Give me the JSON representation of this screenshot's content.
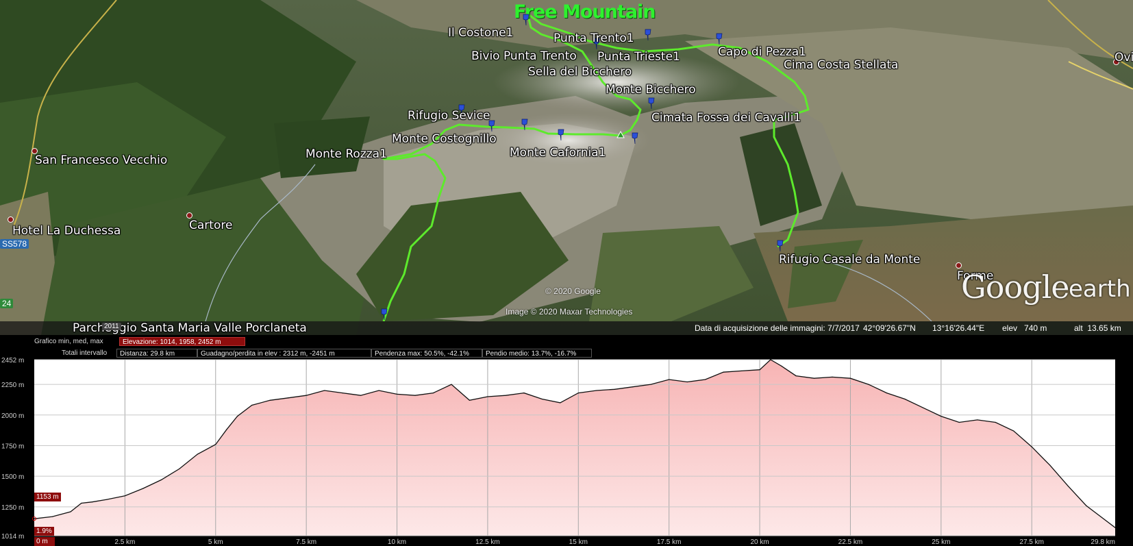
{
  "map": {
    "brand": "Free Mountain",
    "labels": [
      {
        "id": "il-costone",
        "text": "Il Costone1"
      },
      {
        "id": "punta-trento",
        "text": "Punta Trento1"
      },
      {
        "id": "bivio-punta-trento",
        "text": "Bivio Punta Trento"
      },
      {
        "id": "punta-trieste",
        "text": "Punta Trieste1"
      },
      {
        "id": "capo-di-pezza",
        "text": "Capo di Pezza1"
      },
      {
        "id": "cima-costa-stellata",
        "text": "Cima Costa Stellata"
      },
      {
        "id": "sella-del-bicchero",
        "text": "Sella del Bicchero"
      },
      {
        "id": "monte-bicchero",
        "text": "Monte Bicchero"
      },
      {
        "id": "rifugio-sevice",
        "text": "Rifugio Sevice"
      },
      {
        "id": "cimata-fossa",
        "text": "Cimata Fossa dei Cavalli1"
      },
      {
        "id": "monte-costognillo",
        "text": "Monte Costognillo"
      },
      {
        "id": "monte-rozza",
        "text": "Monte Rozza1"
      },
      {
        "id": "monte-cafornia",
        "text": "Monte Cafornia1"
      },
      {
        "id": "san-francesco",
        "text": "San Francesco Vecchio"
      },
      {
        "id": "hotel-la-duchessa",
        "text": "Hotel La Duchessa"
      },
      {
        "id": "cartore",
        "text": "Cartore"
      },
      {
        "id": "rifugio-casale",
        "text": "Rifugio Casale da Monte"
      },
      {
        "id": "forme",
        "text": "Forme"
      },
      {
        "id": "parcheggio",
        "text": "Parcheggio Santa Maria Valle Porclaneta"
      },
      {
        "id": "ovi",
        "text": "Ovi"
      }
    ],
    "road_badges": [
      "SS578",
      "24"
    ],
    "year_badge": "2011",
    "copyright_google": "© 2020 Google",
    "copyright_image": "Image © 2020 Maxar Technologies",
    "logo_text": "Google",
    "logo_suffix": "earth"
  },
  "status": {
    "capture_date": "Data di acquisizione delle immagini: 7/7/2017",
    "lat": "42°09'26.67\"N",
    "lon": "13°16'26.44\"E",
    "elev": "elev   740 m",
    "alt": "alt  13.65 km"
  },
  "profile": {
    "header_label": "Grafico  min, med, max",
    "elevation": "Elevazione: 1014, 1958, 2452 m",
    "totals_label": "Totali intervallo",
    "distance": "Distanza: 29.8 km",
    "gain_loss": "Guadagno/perdita in elev : 2312 m, -2451 m",
    "slope_max": "Pendenza max: 50.5%, -42.1%",
    "slope_avg": "Pendio medio: 13.7%, -16.7%",
    "start_elev_marker": "1153 m",
    "start_slope_marker": "1.9%",
    "start_dist_marker": "0 m"
  },
  "colors": {
    "track": "#5dea2c",
    "brand": "#2ef12e",
    "profile_fill_top": "#f7b4b4",
    "profile_fill_bottom": "#fde8e8",
    "marker": "#8e0d0d",
    "pin": "#2b4fd8"
  },
  "chart_data": {
    "type": "area",
    "xlabel": "",
    "ylabel": "",
    "x_unit": "km",
    "y_unit": "m",
    "xlim": [
      0,
      29.8
    ],
    "ylim": [
      1014,
      2452
    ],
    "yticks": [
      "1014 m",
      "1250 m",
      "1500 m",
      "1750 m",
      "2000 m",
      "2250 m",
      "2452 m"
    ],
    "ytick_values": [
      1014,
      1250,
      1500,
      1750,
      2000,
      2250,
      2452
    ],
    "xticks": [
      "2.5 km",
      "5 km",
      "7.5 km",
      "10 km",
      "12.5 km",
      "15 km",
      "17.5 km",
      "20 km",
      "22.5 km",
      "25 km",
      "27.5 km",
      "29.8 km"
    ],
    "xtick_values": [
      2.5,
      5,
      7.5,
      10,
      12.5,
      15,
      17.5,
      20,
      22.5,
      25,
      27.5,
      29.8
    ],
    "grid": true,
    "x": [
      0,
      0.5,
      1,
      1.3,
      1.6,
      2,
      2.5,
      3,
      3.5,
      4,
      4.5,
      5,
      5.3,
      5.6,
      6,
      6.5,
      7,
      7.5,
      8,
      8.5,
      9,
      9.5,
      10,
      10.5,
      11,
      11.5,
      12,
      12.5,
      13,
      13.5,
      14,
      14.5,
      15,
      15.5,
      16,
      16.5,
      17,
      17.5,
      18,
      18.5,
      19,
      19.5,
      20,
      20.3,
      20.6,
      21,
      21.5,
      22,
      22.5,
      23,
      23.5,
      24,
      24.5,
      25,
      25.5,
      26,
      26.5,
      27,
      27.5,
      28,
      28.5,
      29,
      29.8
    ],
    "y": [
      1153,
      1170,
      1210,
      1280,
      1290,
      1310,
      1340,
      1400,
      1470,
      1560,
      1680,
      1760,
      1880,
      1990,
      2080,
      2120,
      2140,
      2160,
      2200,
      2180,
      2160,
      2200,
      2170,
      2160,
      2180,
      2250,
      2120,
      2150,
      2160,
      2180,
      2130,
      2100,
      2180,
      2200,
      2210,
      2230,
      2250,
      2290,
      2270,
      2290,
      2350,
      2360,
      2370,
      2452,
      2400,
      2320,
      2300,
      2310,
      2300,
      2250,
      2180,
      2130,
      2060,
      1990,
      1940,
      1960,
      1940,
      1870,
      1740,
      1590,
      1420,
      1260,
      1080
    ]
  }
}
